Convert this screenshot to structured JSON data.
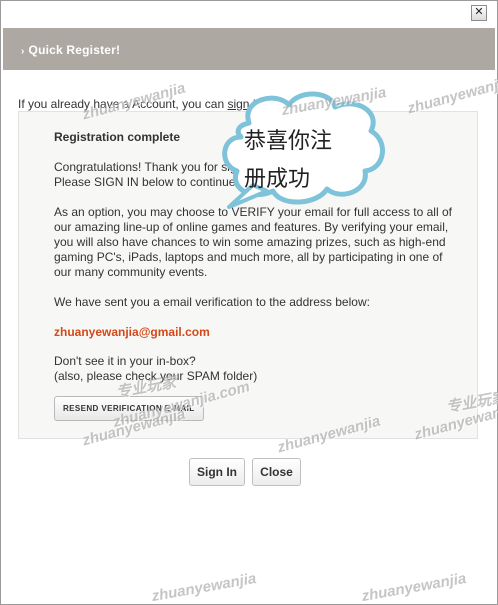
{
  "window": {
    "close_label": "✕"
  },
  "header": {
    "arrow": "›",
    "title": "Quick Register!"
  },
  "intro": {
    "prefix": "If you already have a Account, you can ",
    "link": "sign in"
  },
  "panel": {
    "title": "Registration complete",
    "congrats_lines": [
      "Congratulations! Thank you for signing up!",
      "Please SIGN IN below to continue."
    ],
    "option_lines": [
      "As an option, you may choose to VERIFY your email for full access to all of",
      "our amazing line-up of online games and features. By verifying your email,",
      "you will also have chances to win some amazing prizes, such as high-end",
      "gaming PC's, iPads, laptops and much more, all by participating in one of",
      "our many community events."
    ],
    "sent_text": "We have sent you a email verification to the address below:",
    "email": "zhuanyewanjia@gmail.com",
    "inbox_lines": [
      "Don't see it in your in-box?",
      "(also, please check your SPAM folder)"
    ],
    "resend_label": "RESEND VERIFICATION E-MAIL"
  },
  "buttons": {
    "sign_in": "Sign In",
    "close": "Close"
  },
  "callout": {
    "line1": "恭喜你注",
    "line2": "册成功"
  },
  "watermarks": {
    "text": "zhuanyewanjia",
    "text_com": "zhuanyewanjia.com",
    "text_cn": "专业玩家"
  },
  "colors": {
    "header_bg": "#aea8a3",
    "email": "#d24a1a",
    "panel_bg": "#f7f7f5"
  }
}
